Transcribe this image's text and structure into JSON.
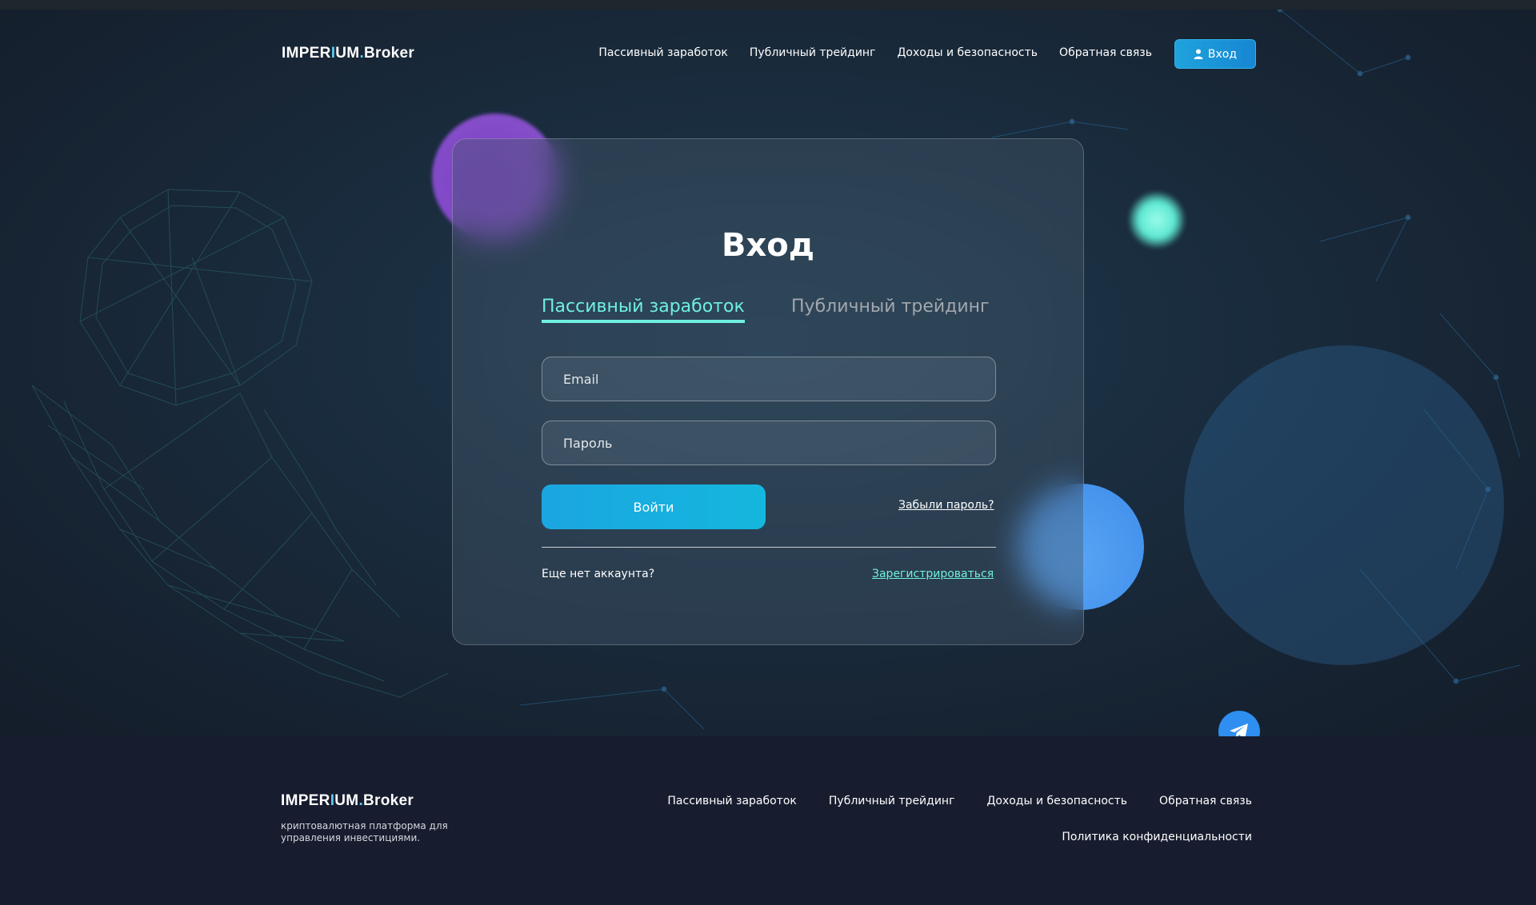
{
  "brand": {
    "name_part1": "IMPER",
    "name_highlight": "I",
    "name_part2": "UM",
    "name_dot": ".",
    "name_part3": "Broker"
  },
  "header": {
    "nav": [
      "Пассивный заработок",
      "Публичный трейдинг",
      "Доходы и безопасность",
      "Обратная связь"
    ],
    "login_button": "Вход",
    "login_icon": "user-icon"
  },
  "login": {
    "title": "Вход",
    "tabs": [
      {
        "label": "Пассивный заработок",
        "active": true
      },
      {
        "label": "Публичный трейдинг",
        "active": false
      }
    ],
    "email_placeholder": "Email",
    "password_placeholder": "Пароль",
    "submit_label": "Войти",
    "forgot_link": "Забыли пароль?",
    "no_account_text": "Еще нет аккаунта?",
    "register_link": "Зарегистрироваться"
  },
  "telegram_icon": "telegram-icon",
  "footer": {
    "description": "криптовалютная платформа для управления инвестициями.",
    "nav": [
      "Пассивный заработок",
      "Публичный трейдинг",
      "Доходы и безопасность",
      "Обратная связь"
    ],
    "privacy_link": "Политика конфиденциальности"
  },
  "colors": {
    "accent_cyan": "#6ff0df",
    "button_blue": "#1aa6e0",
    "footer_bg": "#171c2e",
    "blob_purple": "#7b3ec8",
    "blob_blue": "#3d8cea"
  }
}
